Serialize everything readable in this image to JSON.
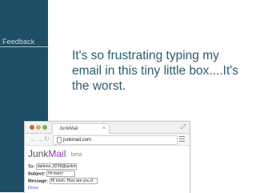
{
  "slide": {
    "section_label": "Feedback",
    "quote": "It's so frustrating typing my email in this tiny little box....It's the worst."
  },
  "browser": {
    "tab_title": "JunkMail",
    "tab_close": "×",
    "url": "junkmail.com",
    "resize_glyph": "⤢"
  },
  "app": {
    "brand_part1": "Junk",
    "brand_part2": "Mail",
    "brand_tag": "beta",
    "fields": {
      "to": {
        "label": "To:",
        "value": "darlene_8239@junkmail"
      },
      "subject": {
        "label": "Subject:",
        "value": "Hi mom!"
      },
      "message": {
        "label": "Message:",
        "value": "Hi mom. How are you d"
      }
    },
    "done_label": "Done"
  }
}
